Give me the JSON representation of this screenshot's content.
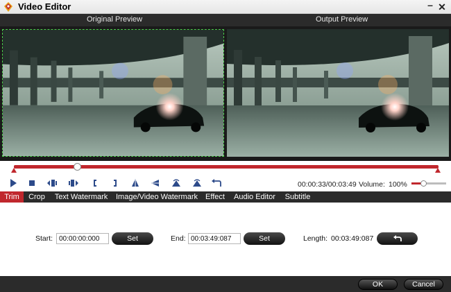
{
  "window": {
    "title": "Video Editor",
    "minimize_label": "–",
    "close_label": "✕",
    "icon": "app-logo-icon"
  },
  "preview": {
    "original_label": "Original Preview",
    "output_label": "Output Preview"
  },
  "playback": {
    "progress_fraction": 0.15,
    "trim_start_fraction": 0.0,
    "trim_end_fraction": 1.0,
    "time_display": "00:00:33/00:03:49",
    "volume_label": "Volume:",
    "volume_value": "100%",
    "volume_fraction": 1.0,
    "controls": [
      "play-icon",
      "stop-icon",
      "previous-frame-icon",
      "next-frame-icon",
      "set-start-bracket-icon",
      "set-end-bracket-icon",
      "flip-vertical-icon",
      "flip-horizontal-icon",
      "rotate-left-icon",
      "rotate-right-icon",
      "undo-icon"
    ]
  },
  "tabs": [
    {
      "label": "Trim",
      "active": true
    },
    {
      "label": "Crop",
      "active": false
    },
    {
      "label": "Text Watermark",
      "active": false
    },
    {
      "label": "Image/Video Watermark",
      "active": false
    },
    {
      "label": "Effect",
      "active": false
    },
    {
      "label": "Audio Editor",
      "active": false
    },
    {
      "label": "Subtitle",
      "active": false
    }
  ],
  "trim": {
    "start_label": "Start:",
    "start_value": "00:00:00:000",
    "end_label": "End:",
    "end_value": "00:03:49:087",
    "length_label": "Length:",
    "length_value": "00:03:49:087",
    "set_label": "Set"
  },
  "footer": {
    "ok_label": "OK",
    "cancel_label": "Cancel"
  },
  "colors": {
    "accent": "#c0272d",
    "dark_bar": "#2b2b2b",
    "crop_border": "#4bd04b"
  }
}
